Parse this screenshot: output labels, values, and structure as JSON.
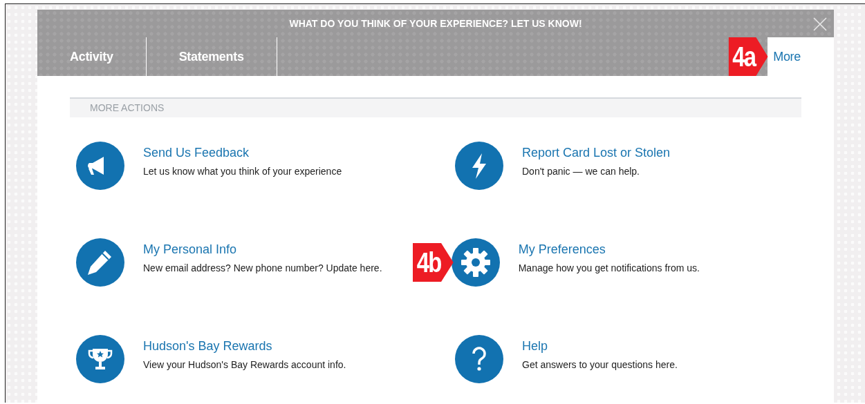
{
  "banner": {
    "text": "WHAT DO YOU THINK OF YOUR EXPERIENCE? LET US KNOW!"
  },
  "tabs": [
    {
      "label": "Activity",
      "selected": false
    },
    {
      "label": "Statements",
      "selected": false
    },
    {
      "label": "More",
      "selected": true,
      "callout": "4a"
    }
  ],
  "section": {
    "title": "MORE ACTIONS"
  },
  "actions": [
    {
      "kind": "megaphone",
      "title": "Send Us Feedback",
      "description": "Let us know what you think of your experience"
    },
    {
      "kind": "bolt",
      "title": "Report Card Lost or Stolen",
      "description": "Don't panic — we can help."
    },
    {
      "kind": "pencil",
      "title": "My Personal Info",
      "description": "New email address? New phone number? Update here."
    },
    {
      "kind": "gear",
      "title": "My Preferences",
      "description": "Manage how you get notifications from us.",
      "callout": "4b"
    },
    {
      "kind": "trophy",
      "title": "Hudson's Bay Rewards",
      "description": "View your Hudson's Bay Rewards account info."
    },
    {
      "kind": "help",
      "title": "Help",
      "description": "Get answers to your questions here."
    }
  ]
}
